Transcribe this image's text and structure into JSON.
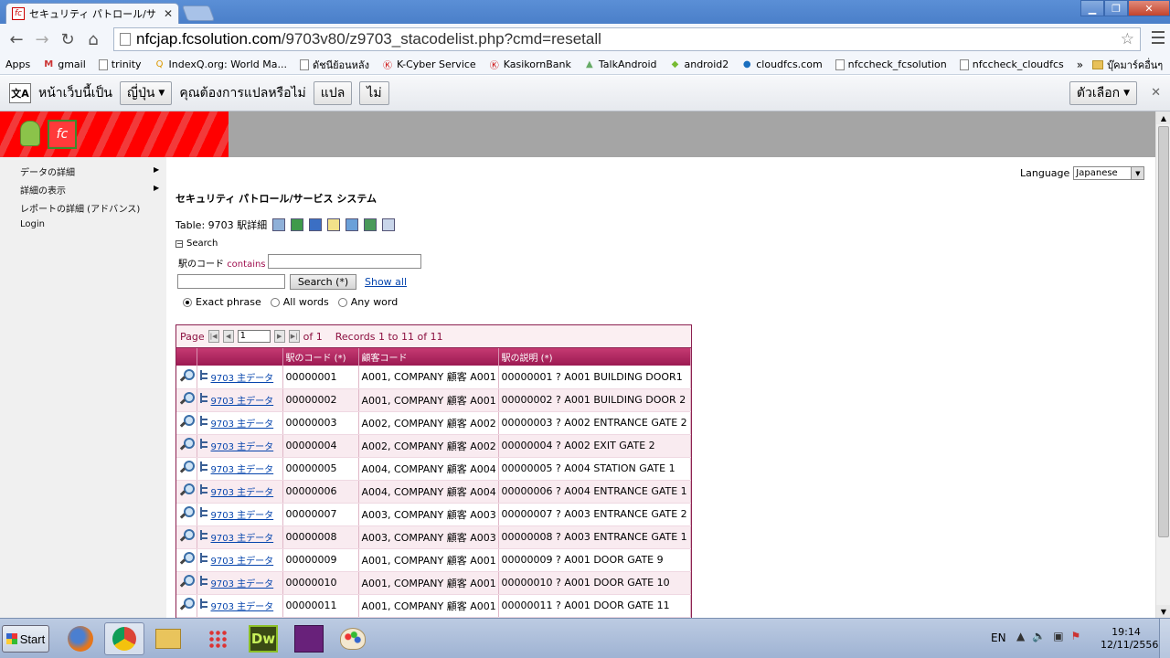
{
  "browser": {
    "tab_title": "セキュリティ パトロール/サ",
    "favicon_text": "fc",
    "url_host": "nfcjap.fcsolution.com",
    "url_path": "/9703v80/z9703_stacodelist.php?cmd=resetall",
    "bookmarks": [
      {
        "label": "Apps",
        "icon": "apps-grid-icon"
      },
      {
        "label": "gmail",
        "icon": "gmail-icon"
      },
      {
        "label": "trinity",
        "icon": "page-icon"
      },
      {
        "label": "IndexQ.org: World Ma...",
        "icon": "indexq-icon"
      },
      {
        "label": "ดัชนีย้อนหลัง",
        "icon": "page-icon"
      },
      {
        "label": "K-Cyber Service",
        "icon": "kbank-icon"
      },
      {
        "label": "KasikornBank",
        "icon": "kbank-icon"
      },
      {
        "label": "TalkAndroid",
        "icon": "talkandroid-icon"
      },
      {
        "label": "android2",
        "icon": "android-icon"
      },
      {
        "label": "cloudfcs.com",
        "icon": "cloud-icon"
      },
      {
        "label": "nfccheck_fcsolution",
        "icon": "page-icon"
      },
      {
        "label": "nfccheck_cloudfcs",
        "icon": "page-icon"
      }
    ],
    "bookmarks_more": "»",
    "other_bookmarks": "บุ๊คมาร์คอื่นๆ"
  },
  "translate_bar": {
    "prefix": "หน้าเว็บนี้เป็น",
    "language": "ญี่ปุ่น",
    "question": "คุณต้องการแปลหรือไม่",
    "translate_button": "แปล",
    "no_button": "ไม่",
    "options_button": "ตัวเลือก"
  },
  "page": {
    "sidebar": [
      {
        "label": "データの詳細",
        "has_submenu": true
      },
      {
        "label": "詳細の表示",
        "has_submenu": true
      },
      {
        "label": "レポートの詳細 (アドバンス)",
        "has_submenu": false
      },
      {
        "label": "Login",
        "has_submenu": false
      }
    ],
    "language_label": "Language",
    "language_value": "Japanese",
    "system_title": "セキュリティ パトロール/サービス システム",
    "table_label": "Table: 9703 駅詳細",
    "search_toggle": "Search",
    "field_label": "駅のコード",
    "field_operator": "contains",
    "search_button": "Search (*)",
    "show_all": "Show all",
    "radio_options": [
      {
        "label": "Exact phrase",
        "checked": true
      },
      {
        "label": "All words",
        "checked": false
      },
      {
        "label": "Any word",
        "checked": false
      }
    ],
    "pager": {
      "page_label": "Page",
      "page_value": "1",
      "of_label": "of 1",
      "records": "Records 1 to 11 of 11"
    },
    "columns": [
      "駅のコード (*)",
      "顧客コード",
      "駅の説明 (*)"
    ],
    "rows": [
      {
        "link": "9703 主データ",
        "code": "00000001",
        "customer": "A001, COMPANY 顧客 A001",
        "desc": "00000001 ? A001 BUILDING DOOR1"
      },
      {
        "link": "9703 主データ",
        "code": "00000002",
        "customer": "A001, COMPANY 顧客 A001",
        "desc": "00000002 ? A001 BUILDING DOOR 2"
      },
      {
        "link": "9703 主データ",
        "code": "00000003",
        "customer": "A002, COMPANY 顧客 A002",
        "desc": "00000003 ? A002 ENTRANCE GATE 2"
      },
      {
        "link": "9703 主データ",
        "code": "00000004",
        "customer": "A002, COMPANY 顧客 A002",
        "desc": "00000004 ? A002 EXIT GATE 2"
      },
      {
        "link": "9703 主データ",
        "code": "00000005",
        "customer": "A004, COMPANY 顧客 A004",
        "desc": "00000005 ? A004 STATION GATE 1"
      },
      {
        "link": "9703 主データ",
        "code": "00000006",
        "customer": "A004, COMPANY 顧客 A004",
        "desc": "00000006 ? A004 ENTRANCE GATE 1"
      },
      {
        "link": "9703 主データ",
        "code": "00000007",
        "customer": "A003, COMPANY 顧客 A003",
        "desc": "00000007 ? A003 ENTRANCE GATE 2"
      },
      {
        "link": "9703 主データ",
        "code": "00000008",
        "customer": "A003, COMPANY 顧客 A003",
        "desc": "00000008 ? A003 ENTRANCE GATE 1"
      },
      {
        "link": "9703 主データ",
        "code": "00000009",
        "customer": "A001, COMPANY 顧客 A001",
        "desc": "00000009 ? A001 DOOR GATE 9"
      },
      {
        "link": "9703 主データ",
        "code": "00000010",
        "customer": "A001, COMPANY 顧客 A001",
        "desc": "00000010 ? A001 DOOR GATE 10"
      },
      {
        "link": "9703 主データ",
        "code": "00000011",
        "customer": "A001, COMPANY 顧客 A001",
        "desc": "00000011 ? A001 DOOR GATE 11"
      }
    ]
  },
  "taskbar": {
    "start_label": "Start",
    "apps": [
      "firefox-icon",
      "chrome-icon",
      "explorer-icon",
      "apps-icon",
      "dreamweaver-icon",
      "visual-studio-icon",
      "paint-icon"
    ],
    "dreamweaver_label": "Dw",
    "lang": "EN",
    "time": "19:14",
    "date": "12/11/2556"
  },
  "colors": {
    "grid_header": "#9c1a52",
    "banner_red": "#ff0000",
    "banner_gray": "#a5a5a5",
    "chrome_blue": "#4a7fc9"
  }
}
